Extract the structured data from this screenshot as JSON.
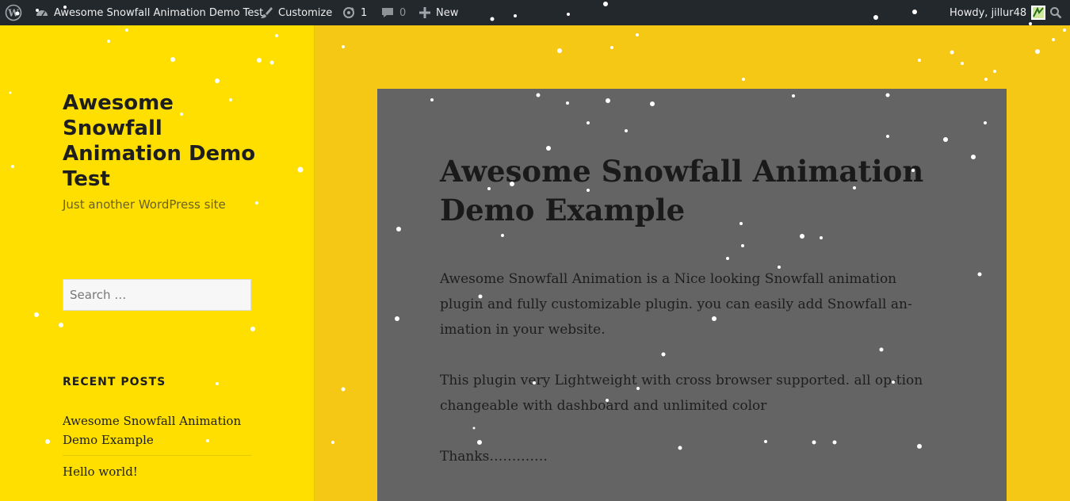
{
  "admin_bar": {
    "site_name": "Awesome Snowfall Animation Demo Test",
    "customize_label": "Customize",
    "updates_count": "1",
    "comments_count": "0",
    "new_label": "New",
    "howdy_text": "Howdy, jillur48",
    "icons": [
      "wordpress-logo-icon",
      "dashboard-icon",
      "brush-icon",
      "updates-icon",
      "comment-icon",
      "plus-icon",
      "avatar",
      "search-icon"
    ]
  },
  "sidebar": {
    "site_title": "Awesome Snowfall Animation Demo Test",
    "site_description": "Just another WordPress site",
    "search_placeholder": "Search …",
    "recent_posts_title": "RECENT POSTS",
    "recent_posts": [
      "Awesome Snowfall Animation Demo Example",
      "Hello world!"
    ]
  },
  "article": {
    "title": "Awesome Snowfall Animation Demo Example",
    "paragraphs": [
      "Awesome Snowfall Animation is a Nice looking Snowfall animation plugin and fully customizable plugin. you can easily add Snowfall an-imation in your website.",
      "This plugin very Lightweight with cross browser supported. all op-tion changeable with dashboard and unlimited color",
      "Thanks…………."
    ]
  },
  "colors": {
    "sidebar_bg": "#fedf00",
    "page_bg": "#f5c816",
    "article_bg": "#646464",
    "admin_bar_bg": "#23282d",
    "snow": "#ffffff"
  }
}
